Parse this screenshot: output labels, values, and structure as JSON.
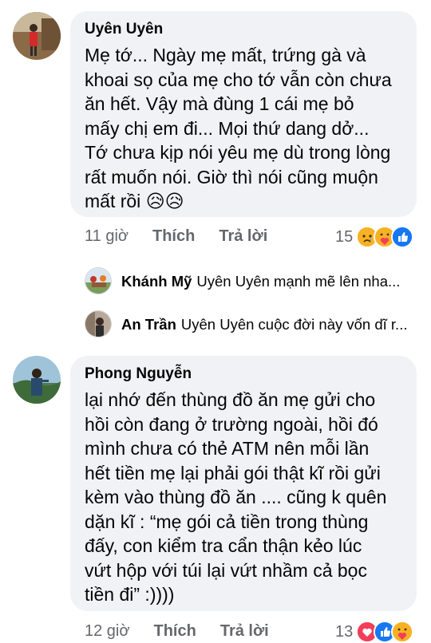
{
  "comments": [
    {
      "author": "Uyên Uyên",
      "text": "Mẹ tớ... Ngày mẹ mất, trứng gà và\nkhoai sọ của mẹ cho tớ vẫn còn chưa\năn hết. Vậy mà đùng 1 cái mẹ bỏ\nmấy chị em đi... Mọi thứ dang dở...\nTớ chưa kịp nói yêu mẹ dù trong lòng\nrất muốn nói. Giờ thì nói cũng muộn\nmất rồi",
      "emojis": "😥😥",
      "time": "11 giờ",
      "like_label": "Thích",
      "reply_label": "Trả lời",
      "reaction_count": "15",
      "reactions": [
        "sad-icon",
        "care-icon",
        "like-icon"
      ]
    },
    {
      "author": "Phong Nguyễn",
      "text": "lại nhớ đến thùng đồ ăn mẹ gửi cho\nhồi còn đang ở trường ngoài, hồi đó\nmình chưa có thẻ ATM nên mỗi lần\nhết tiền mẹ lại phải gói thật kĩ rồi gửi\nkèm vào thùng đồ ăn .... cũng k quên\ndặn kĩ : “mẹ gói cả tiền trong thùng\nđấy, con kiểm tra cẩn thận kẻo lúc\nvứt hộp với túi lại vứt nhầm cả bọc\ntiền đi” :))))",
      "time": "12 giờ",
      "like_label": "Thích",
      "reply_label": "Trả lời",
      "reaction_count": "13",
      "reactions": [
        "love-icon",
        "like-icon",
        "care-icon"
      ]
    }
  ],
  "replies": [
    {
      "author": "Khánh Mỹ",
      "text": "Uyên Uyên  mạnh mẽ lên nha..."
    },
    {
      "author": "An Trần",
      "text": "Uyên Uyên cuộc đời này vốn dĩ r..."
    }
  ],
  "colors": {
    "bubble": "#f0f2f5",
    "muted": "#65676b",
    "like_blue": "#1877f2",
    "love_red": "#f33e58",
    "emoji_yellow": "#f7b125"
  }
}
